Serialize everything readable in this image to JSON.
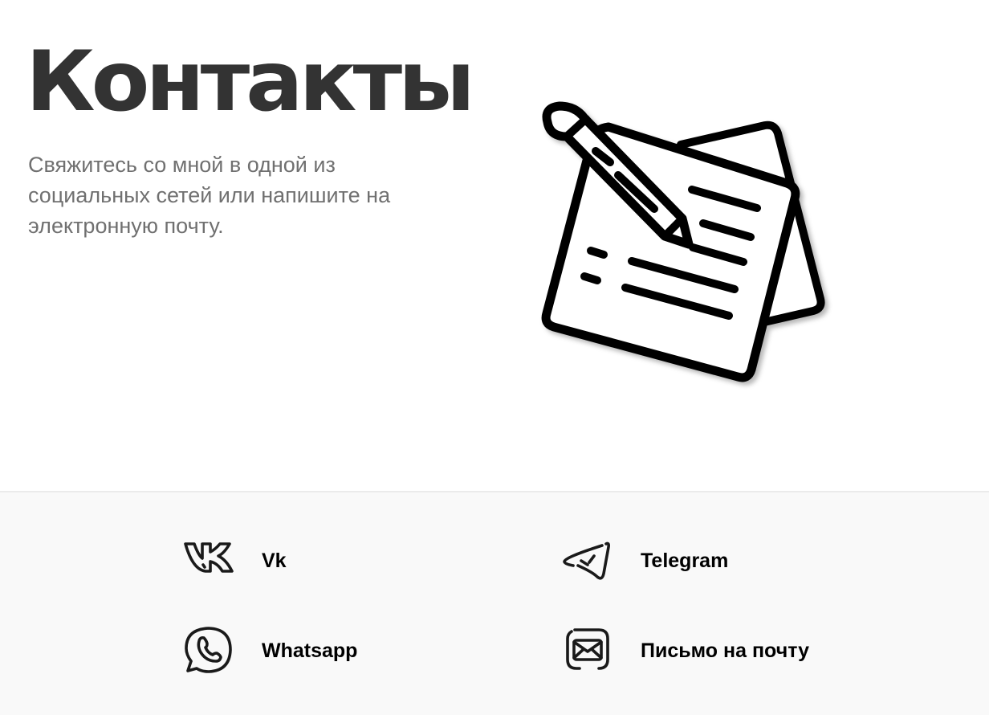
{
  "hero": {
    "title": "Контакты",
    "subtitle": "Свяжитесь со мной в одной из социальных сетей или напишите на электронную почту.",
    "illustration": "notes-with-pencil-icon"
  },
  "contacts": [
    {
      "label": "Vk",
      "icon": "vk-icon"
    },
    {
      "label": "Telegram",
      "icon": "telegram-icon"
    },
    {
      "label": "Whatsapp",
      "icon": "whatsapp-icon"
    },
    {
      "label": "Письмо на почту",
      "icon": "mail-icon"
    }
  ],
  "colors": {
    "title": "#333333",
    "subtitle": "#707070",
    "contacts_background": "#f9f9f9",
    "icon_stroke": "#1a1a1a"
  }
}
